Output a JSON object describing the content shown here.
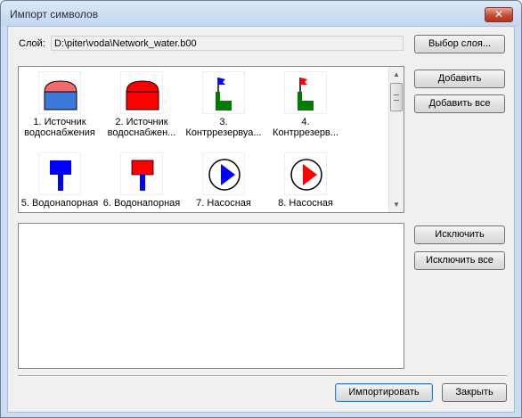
{
  "window": {
    "title": "Импорт символов",
    "close_label": "✕"
  },
  "layer": {
    "label": "Слой:",
    "path": "D:\\piter\\voda\\Network_water.b00"
  },
  "buttons": {
    "select_layer": "Выбор слоя...",
    "add": "Добавить",
    "add_all": "Добавить все",
    "exclude": "Исключить",
    "exclude_all": "Исключить все",
    "import": "Импортировать",
    "close": "Закрыть"
  },
  "symbols": [
    {
      "caption": "1. Источник\nводоснабжения",
      "icon": "reservoir-icon",
      "color": "#f06a6a",
      "accent": "#3c78d8"
    },
    {
      "caption": "2. Источник\nводоснабжен...",
      "icon": "reservoir-icon",
      "color": "#ff0000",
      "accent": "#ff0000"
    },
    {
      "caption": "3.\nКонтррезервуа...",
      "icon": "counter-reservoir-icon",
      "color": "#007a00",
      "accent": "#0000ff"
    },
    {
      "caption": "4.\nКонтррезерв...",
      "icon": "counter-reservoir-icon",
      "color": "#007a00",
      "accent": "#ff0000"
    },
    {
      "caption": "5. Водонапорная",
      "icon": "water-tower-icon",
      "color": "#0000ff"
    },
    {
      "caption": "6. Водонапорная",
      "icon": "water-tower-icon",
      "color": "#ff0000",
      "accent": "#0000ff"
    },
    {
      "caption": "7. Насосная",
      "icon": "pump-station-icon",
      "color": "#0000ff"
    },
    {
      "caption": "8. Насосная",
      "icon": "pump-station-icon",
      "color": "#ff0000"
    }
  ]
}
